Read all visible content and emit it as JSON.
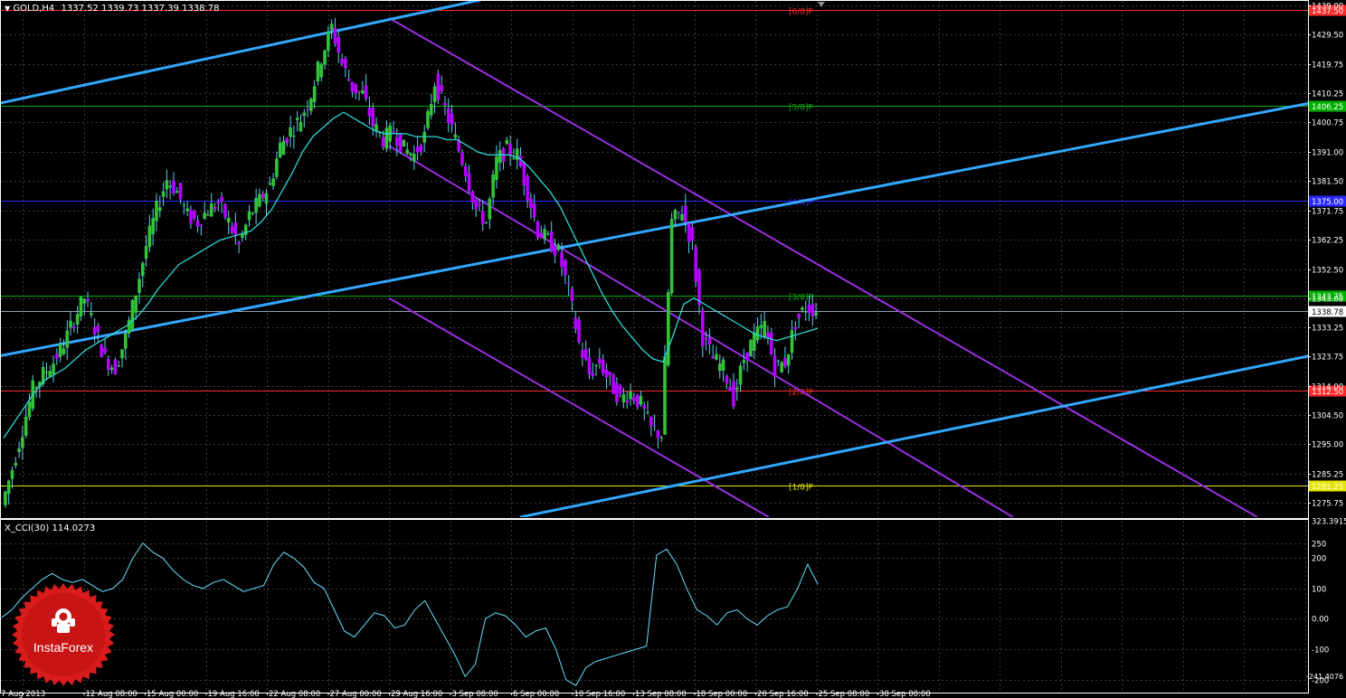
{
  "header": {
    "symbol_info": "GOLD,H4",
    "ohlc": "1337.52 1339.73 1337.39 1338.78",
    "indicator_info": "X_CCI(30) 114.0273"
  },
  "logo": {
    "text": "InstaForex"
  },
  "colors": {
    "background": "#000000",
    "grid": "#3a3a3a",
    "bull_candle": "#33c23a",
    "bear_candle": "#b400ff",
    "candle_wick": "#5fd0f0",
    "ma_line": "#2fd6d6",
    "channel_blue": "#33a7ff",
    "channel_purple": "#9a2ee0",
    "cci_line": "#66e0ff",
    "logo_red": "#d81b1b"
  },
  "chart_data": [
    {
      "type": "candlestick",
      "symbol": "GOLD",
      "timeframe": "H4",
      "y_range": [
        1271.0,
        1440.0
      ],
      "price_ticks": [
        1439.0,
        1429.5,
        1419.75,
        1410.25,
        1400.75,
        1391.0,
        1381.5,
        1371.75,
        1362.25,
        1352.5,
        1343.0,
        1333.25,
        1323.75,
        1314.0,
        1304.5,
        1295.0,
        1285.25,
        1275.75
      ],
      "time_labels": [
        "7 Aug 2013",
        "12 Aug 08:00",
        "15 Aug 00:00",
        "19 Aug 16:00",
        "22 Aug 08:00",
        "27 Aug 00:00",
        "29 Aug 16:00",
        "3 Sep 08:00",
        "6 Sep 00:00",
        "10 Sep 16:00",
        "13 Sep 08:00",
        "18 Sep 00:00",
        "20 Sep 16:00",
        "25 Sep 08:00",
        "30 Sep 00:00"
      ],
      "current_price": 1338.78,
      "price_series": [
        1275,
        1287,
        1300,
        1313,
        1318,
        1322,
        1328,
        1336,
        1343,
        1333,
        1323,
        1320,
        1330,
        1345,
        1360,
        1372,
        1382,
        1378,
        1370,
        1368,
        1372,
        1374,
        1368,
        1360,
        1370,
        1375,
        1380,
        1393,
        1398,
        1402,
        1410,
        1422,
        1432,
        1420,
        1412,
        1410,
        1400,
        1395,
        1398,
        1392,
        1390,
        1396,
        1414,
        1405,
        1395,
        1385,
        1372,
        1368,
        1388,
        1392,
        1390,
        1378,
        1365,
        1362,
        1358,
        1345,
        1328,
        1318,
        1322,
        1315,
        1310,
        1312,
        1308,
        1300,
        1298,
        1368,
        1372,
        1360,
        1330,
        1323,
        1320,
        1310,
        1323,
        1330,
        1334,
        1320,
        1322,
        1335,
        1340,
        1339
      ],
      "ma_series": [
        1297,
        1302,
        1307,
        1312,
        1316,
        1318,
        1320,
        1323,
        1326,
        1328,
        1330,
        1332,
        1334,
        1337,
        1341,
        1346,
        1350,
        1354,
        1356,
        1358,
        1360,
        1362,
        1363,
        1364,
        1365,
        1368,
        1372,
        1378,
        1384,
        1391,
        1396,
        1399,
        1402,
        1404,
        1402,
        1400,
        1398,
        1397,
        1397,
        1397,
        1396,
        1396,
        1396,
        1395,
        1395,
        1393,
        1391,
        1390,
        1390,
        1390,
        1389,
        1386,
        1382,
        1378,
        1373,
        1366,
        1359,
        1352,
        1345,
        1339,
        1334,
        1330,
        1326,
        1323,
        1322,
        1331,
        1341,
        1343,
        1341,
        1339,
        1337,
        1335,
        1333,
        1331,
        1330,
        1329,
        1330,
        1331,
        1332,
        1333
      ],
      "murrey_levels": [
        {
          "label": "[6/8]P",
          "price": 1437.5,
          "price_text": "1437.50",
          "color": "#ff2a2a"
        },
        {
          "label": "[5/8]P",
          "price": 1406.25,
          "price_text": "1406.25",
          "color": "#00b000"
        },
        {
          "label": "[4/8]P",
          "price": 1375.0,
          "price_text": "1375.00",
          "color": "#2a2aff"
        },
        {
          "label": "[3/8]P",
          "price": 1343.75,
          "price_text": "1343.75",
          "color": "#00b000"
        },
        {
          "label": "[2/8]P",
          "price": 1312.5,
          "price_text": "1312.50",
          "color": "#ff2a2a"
        },
        {
          "label": "[1/8]P",
          "price": 1281.25,
          "price_text": "1281.25",
          "color": "#e6e600"
        }
      ],
      "blue_channel": [
        {
          "x1": 0,
          "p1": 1407,
          "x2": 595,
          "p2": 1445
        },
        {
          "x1": 0,
          "p1": 1324,
          "x2": 1448,
          "p2": 1407
        },
        {
          "x1": 575,
          "p1": 1271,
          "x2": 1448,
          "p2": 1324
        }
      ],
      "purple_channel": [
        {
          "x1": 430,
          "p1": 1435,
          "x2": 1390,
          "p2": 1271
        },
        {
          "x1": 430,
          "p1": 1393,
          "x2": 1120,
          "p2": 1271
        },
        {
          "x1": 430,
          "p1": 1343,
          "x2": 850,
          "p2": 1271
        }
      ]
    },
    {
      "type": "line",
      "name": "X_CCI(30)",
      "y_range": [
        -240,
        323.3915
      ],
      "y_ticks": [
        323.3915,
        250,
        200,
        100,
        0.0,
        -100,
        -200
      ],
      "y_tick_labels": [
        "323.3915",
        "250",
        "200",
        "100",
        "0.00",
        "-100",
        "-200"
      ],
      "min_label": "-241.4076",
      "values": [
        5,
        30,
        70,
        100,
        130,
        150,
        130,
        120,
        130,
        110,
        90,
        100,
        130,
        200,
        250,
        220,
        200,
        160,
        130,
        110,
        100,
        120,
        130,
        110,
        90,
        100,
        110,
        180,
        220,
        200,
        170,
        120,
        100,
        30,
        -40,
        -60,
        -20,
        20,
        10,
        -30,
        -20,
        30,
        60,
        0,
        -60,
        -120,
        -190,
        -150,
        0,
        20,
        10,
        -20,
        -60,
        -40,
        -30,
        -100,
        -200,
        -220,
        -160,
        -140,
        -130,
        -120,
        -110,
        -100,
        -90,
        210,
        230,
        180,
        100,
        30,
        10,
        -20,
        20,
        30,
        0,
        -20,
        10,
        30,
        40,
        100,
        180,
        114
      ]
    }
  ]
}
